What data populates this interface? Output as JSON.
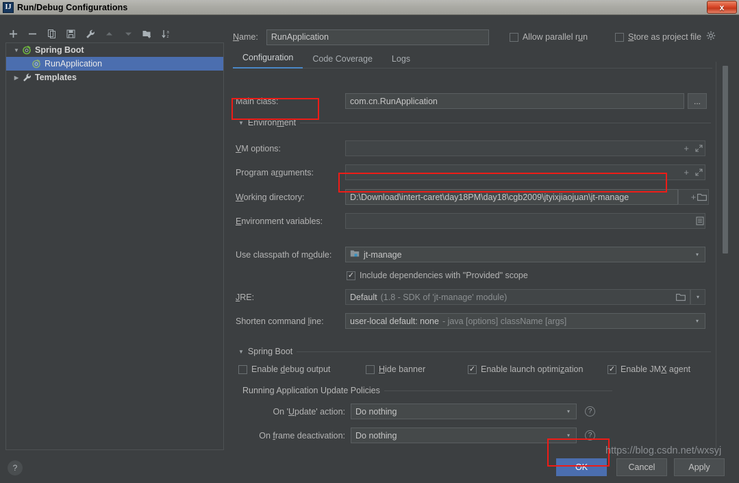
{
  "window": {
    "title": "Run/Debug Configurations",
    "app_icon": "idea-icon",
    "close_label": "x"
  },
  "left_toolbar": {
    "buttons": [
      {
        "name": "add-configuration-button",
        "icon": "plus-icon",
        "label": "+"
      },
      {
        "name": "remove-configuration-button",
        "icon": "minus-icon",
        "label": "−"
      },
      {
        "name": "copy-configuration-button",
        "icon": "copy-icon",
        "label": "copy"
      },
      {
        "name": "save-configuration-button",
        "icon": "save-icon",
        "label": "save"
      },
      {
        "name": "edit-templates-button",
        "icon": "wrench-icon",
        "label": "wrench"
      },
      {
        "name": "move-up-button",
        "icon": "arrow-up-icon",
        "label": "up"
      },
      {
        "name": "move-down-button",
        "icon": "arrow-down-icon",
        "label": "down"
      },
      {
        "name": "new-folder-button",
        "icon": "folder-add-icon",
        "label": "new folder"
      },
      {
        "name": "sort-button",
        "icon": "sort-alpha-icon",
        "label": "sort"
      }
    ]
  },
  "tree": {
    "nodes": [
      {
        "label": "Spring Boot",
        "level": 1,
        "expanded": true,
        "selected": false,
        "icon": "spring-boot-icon",
        "twisty": "▼"
      },
      {
        "label": "RunApplication",
        "level": 2,
        "expanded": false,
        "selected": true,
        "icon": "spring-boot-icon",
        "twisty": ""
      },
      {
        "label": "Templates",
        "level": 1,
        "expanded": false,
        "selected": false,
        "icon": "wrench-icon",
        "twisty": "▶"
      }
    ]
  },
  "header": {
    "name_label": "Name:",
    "name_value": "RunApplication",
    "name_placeholder": "",
    "allow_parallel_run": {
      "label": "Allow parallel run",
      "checked": false
    },
    "store_as_project_file": {
      "label": "Store as project file",
      "checked": false
    },
    "gear_icon": "gear-icon"
  },
  "tabs": [
    {
      "label": "Configuration",
      "active": true
    },
    {
      "label": "Code Coverage",
      "active": false
    },
    {
      "label": "Logs",
      "active": false
    }
  ],
  "form": {
    "main_class": {
      "label": "Main class:",
      "value": "com.cn.RunApplication",
      "browse_label": "..."
    },
    "environment_section": {
      "label": "Environment",
      "expanded": true,
      "twisty": "▼"
    },
    "vm_options": {
      "label": "VM options:",
      "value": "",
      "macro_icon": "plus-icon",
      "expand_icon": "expand-icon"
    },
    "program_arguments": {
      "label": "Program arguments:",
      "value": "",
      "macro_icon": "plus-icon",
      "expand_icon": "expand-icon"
    },
    "working_directory": {
      "label": "Working directory:",
      "value": "D:\\Download\\intert-caret\\day18PM\\day18\\cgb2009\\jtyixjiaojuan\\jt-manage",
      "macro_icon": "plus-icon",
      "browse_icon": "folder-icon"
    },
    "environment_variables": {
      "label": "Environment variables:",
      "value": "",
      "edit_icon": "list-edit-icon"
    },
    "use_classpath_of_module": {
      "label": "Use classpath of module:",
      "value": "jt-manage",
      "module_icon": "module-icon",
      "arrow": "▾"
    },
    "include_provided_scope": {
      "label": "Include dependencies with \"Provided\" scope",
      "checked": true
    },
    "jre": {
      "label": "JRE:",
      "value": "Default",
      "hint": "(1.8 - SDK of 'jt-manage' module)",
      "browse_icon": "folder-icon",
      "arrow": "▾"
    },
    "shorten_command_line": {
      "label": "Shorten command line:",
      "value": "user-local default: none",
      "hint": "- java [options] className [args]",
      "arrow": "▾"
    },
    "spring_boot_section": {
      "label": "Spring Boot",
      "expanded": true,
      "twisty": "▼"
    },
    "spring_boot_checkboxes": [
      {
        "name": "enable-debug-output",
        "label": "Enable debug output",
        "checked": false
      },
      {
        "name": "hide-banner",
        "label": "Hide banner",
        "checked": false
      },
      {
        "name": "enable-launch-optimization",
        "label": "Enable launch optimization",
        "checked": true
      },
      {
        "name": "enable-jmx-agent",
        "label": "Enable JMX agent",
        "checked": true
      }
    ],
    "update_policies_section": {
      "label": "Running Application Update Policies"
    },
    "on_update_action": {
      "label": "On 'Update' action:",
      "value": "Do nothing",
      "arrow": "▾",
      "help_icon": "help-circle-icon"
    },
    "on_frame_deactivation": {
      "label": "On frame deactivation:",
      "value": "Do nothing",
      "arrow": "▾",
      "help_icon": "help-circle-icon"
    }
  },
  "bottom": {
    "help_label": "?",
    "ok_label": "OK",
    "cancel_label": "Cancel",
    "apply_label": "Apply"
  },
  "watermark": "https://blog.csdn.net/wxsyj",
  "colors": {
    "background": "#3c3f41",
    "field_background": "#45494a",
    "accent_blue": "#4b6eaf",
    "tab_underline": "#4a88c7",
    "annotation_red": "#ee1c17",
    "text_primary": "#b4b4b4",
    "titlebar": "#a9a9a3"
  }
}
